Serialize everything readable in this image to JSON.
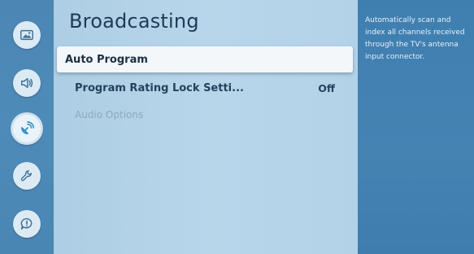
{
  "rail": {
    "items": [
      {
        "icon": "picture-icon",
        "active": false
      },
      {
        "icon": "sound-icon",
        "active": false
      },
      {
        "icon": "broadcasting-icon",
        "active": true
      },
      {
        "icon": "wrench-icon",
        "active": false
      },
      {
        "icon": "support-icon",
        "active": false
      }
    ]
  },
  "page": {
    "title": "Broadcasting"
  },
  "menu": {
    "items": [
      {
        "label": "Auto Program",
        "value": "",
        "state": "selected"
      },
      {
        "label": "Program Rating Lock Setti...",
        "value": "Off",
        "state": "normal"
      },
      {
        "label": "Audio Options",
        "value": "",
        "state": "disabled"
      }
    ]
  },
  "info": {
    "text": "Automatically scan and index all channels received through the TV's antenna input connector."
  },
  "colors": {
    "rail": "#4b86b5",
    "info_panel": "#4583b3",
    "content_bg": "#b8d6ea",
    "selected_bg": "#f3f7fa"
  }
}
